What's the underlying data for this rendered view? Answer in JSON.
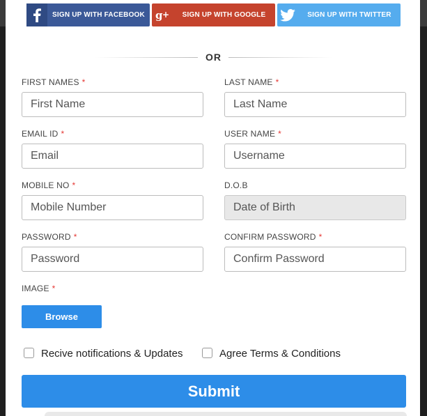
{
  "social": {
    "facebook_label": "SIGN UP WITH FACEBOOK",
    "google_label": "SIGN UP WITH GOOGLE",
    "twitter_label": "SIGN UP WITH TWITTER",
    "facebook_icon": "facebook-icon",
    "google_icon": "google-plus-icon",
    "twitter_icon": "twitter-icon"
  },
  "divider": {
    "text": "OR"
  },
  "required_mark": "*",
  "fields": {
    "first_name": {
      "label": "FIRST NAMES",
      "placeholder": "First Name"
    },
    "last_name": {
      "label": "LAST NAME",
      "placeholder": "Last Name"
    },
    "email": {
      "label": "EMAIL ID",
      "placeholder": "Email"
    },
    "username": {
      "label": "USER NAME",
      "placeholder": "Username"
    },
    "mobile": {
      "label": "MOBILE NO",
      "placeholder": "Mobile Number"
    },
    "dob": {
      "label": "D.O.B",
      "placeholder": "Date of Birth"
    },
    "password": {
      "label": "PASSWORD",
      "placeholder": "Password"
    },
    "confirm_password": {
      "label": "CONFIRM PASSWORD",
      "placeholder": "Confirm Password"
    }
  },
  "image": {
    "label": "IMAGE",
    "browse_label": "Browse"
  },
  "checkboxes": {
    "notifications": "Recive notifications & Updates",
    "terms": "Agree Terms & Conditions"
  },
  "submit_label": "Submit",
  "colors": {
    "facebook": "#3b5998",
    "google": "#c5432d",
    "twitter": "#55acee",
    "accent": "#2d8de8",
    "required": "#e53935"
  }
}
